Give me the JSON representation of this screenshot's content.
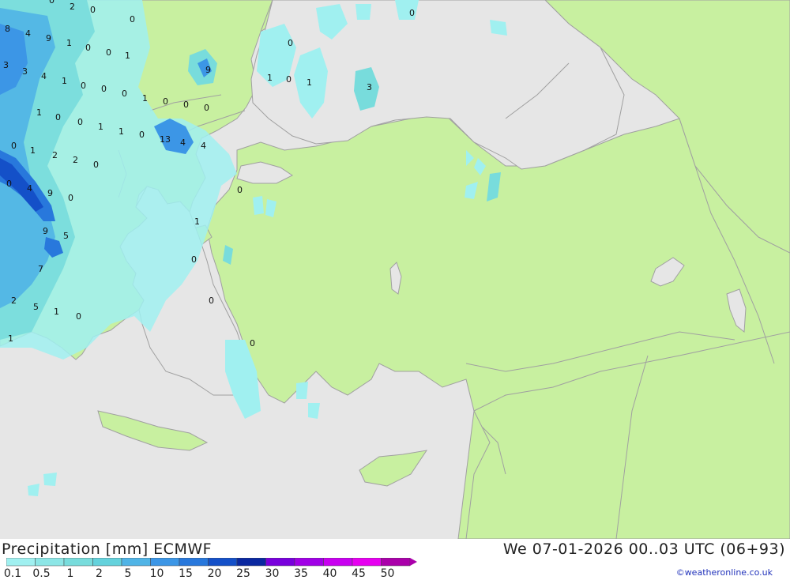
{
  "header": {
    "title": "Precipitation [mm] ECMWF",
    "datetime": "We 07-01-2026 00..03 UTC (06+93)"
  },
  "legend": {
    "levels": [
      "0.1",
      "0.5",
      "1",
      "2",
      "5",
      "10",
      "15",
      "20",
      "25",
      "30",
      "35",
      "40",
      "45",
      "50"
    ],
    "colors": [
      "#a0f0f0",
      "#8ce6e6",
      "#78dcdc",
      "#64d2dc",
      "#50b4e6",
      "#3c96e6",
      "#2878dc",
      "#1450c8",
      "#0a28a0",
      "#7800dc",
      "#a000e6",
      "#c800f0",
      "#e600f0",
      "#aa00aa"
    ]
  },
  "credit": "©weatheronline.co.uk",
  "map": {
    "land_color": "#c8f0a0",
    "sea_color": "#e6e6e6",
    "border_color": "#a0a0a0",
    "values": [
      {
        "t": "0"
      },
      {
        "t": "2"
      },
      {
        "t": "0"
      },
      {
        "t": "0"
      },
      {
        "t": "0"
      },
      {
        "t": "8"
      },
      {
        "t": "4"
      },
      {
        "t": "9"
      },
      {
        "t": "1"
      },
      {
        "t": "0"
      },
      {
        "t": "0"
      },
      {
        "t": "1"
      },
      {
        "t": "3"
      },
      {
        "t": "3"
      },
      {
        "t": "4"
      },
      {
        "t": "1"
      },
      {
        "t": "0"
      },
      {
        "t": "0"
      },
      {
        "t": "0"
      },
      {
        "t": "1"
      },
      {
        "t": "0"
      },
      {
        "t": "0"
      },
      {
        "t": "0"
      },
      {
        "t": "9"
      },
      {
        "t": "0"
      },
      {
        "t": "1"
      },
      {
        "t": "0"
      },
      {
        "t": "1"
      },
      {
        "t": "3"
      },
      {
        "t": "1"
      },
      {
        "t": "0"
      },
      {
        "t": "0"
      },
      {
        "t": "1"
      },
      {
        "t": "1"
      },
      {
        "t": "0"
      },
      {
        "t": "13"
      },
      {
        "t": "4"
      },
      {
        "t": "4"
      },
      {
        "t": "0"
      },
      {
        "t": "1"
      },
      {
        "t": "2"
      },
      {
        "t": "2"
      },
      {
        "t": "0"
      },
      {
        "t": "0"
      },
      {
        "t": "4"
      },
      {
        "t": "9"
      },
      {
        "t": "0"
      },
      {
        "t": "0"
      },
      {
        "t": "9"
      },
      {
        "t": "5"
      },
      {
        "t": "1"
      },
      {
        "t": "0"
      },
      {
        "t": "7"
      },
      {
        "t": "2"
      },
      {
        "t": "5"
      },
      {
        "t": "1"
      },
      {
        "t": "0"
      },
      {
        "t": "0"
      },
      {
        "t": "1"
      },
      {
        "t": "0"
      }
    ]
  }
}
